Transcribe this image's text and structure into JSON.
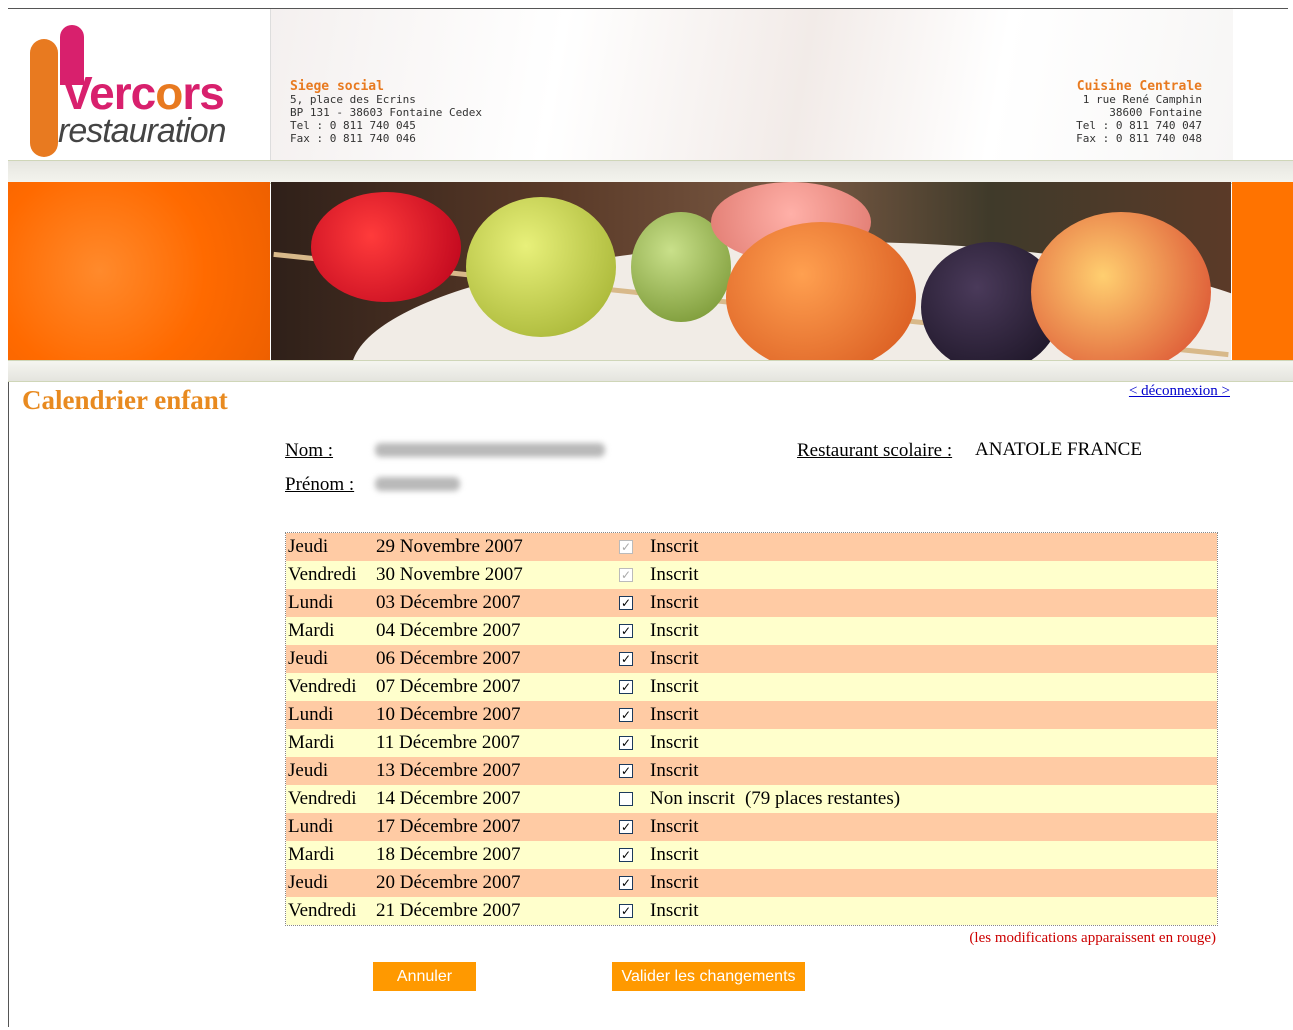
{
  "brand": {
    "logo_text_main": "Vercors",
    "logo_text_sub": "restauration"
  },
  "header": {
    "left_office": {
      "title": "Siege social",
      "lines": [
        "5, place des Ecrins",
        "BP 131 - 38603 Fontaine Cedex",
        "Tel :  0 811 740 045",
        "Fax : 0 811 740 046"
      ]
    },
    "right_office": {
      "title": "Cuisine Centrale",
      "lines": [
        "1 rue René Camphin",
        "38600 Fontaine",
        "Tel : 0 811 740 047",
        "Fax : 0 811 740 048"
      ]
    }
  },
  "page": {
    "title": "Calendrier enfant",
    "logout_link": "< déconnexion >"
  },
  "child": {
    "nom_label": "Nom :",
    "prenom_label": "Prénom :",
    "restaurant_label": "Restaurant scolaire :",
    "restaurant_value": "ANATOLE FRANCE"
  },
  "calendar": [
    {
      "day": "Jeudi",
      "date": "29 Novembre 2007",
      "checked": true,
      "disabled": true,
      "status": "Inscrit",
      "extra": ""
    },
    {
      "day": "Vendredi",
      "date": "30 Novembre 2007",
      "checked": true,
      "disabled": true,
      "status": "Inscrit",
      "extra": ""
    },
    {
      "day": "Lundi",
      "date": "03 Décembre 2007",
      "checked": true,
      "disabled": false,
      "status": "Inscrit",
      "extra": ""
    },
    {
      "day": "Mardi",
      "date": "04 Décembre 2007",
      "checked": true,
      "disabled": false,
      "status": "Inscrit",
      "extra": ""
    },
    {
      "day": "Jeudi",
      "date": "06 Décembre 2007",
      "checked": true,
      "disabled": false,
      "status": "Inscrit",
      "extra": ""
    },
    {
      "day": "Vendredi",
      "date": "07 Décembre 2007",
      "checked": true,
      "disabled": false,
      "status": "Inscrit",
      "extra": ""
    },
    {
      "day": "Lundi",
      "date": "10 Décembre 2007",
      "checked": true,
      "disabled": false,
      "status": "Inscrit",
      "extra": ""
    },
    {
      "day": "Mardi",
      "date": "11 Décembre 2007",
      "checked": true,
      "disabled": false,
      "status": "Inscrit",
      "extra": ""
    },
    {
      "day": "Jeudi",
      "date": "13 Décembre 2007",
      "checked": true,
      "disabled": false,
      "status": "Inscrit",
      "extra": ""
    },
    {
      "day": "Vendredi",
      "date": "14 Décembre 2007",
      "checked": false,
      "disabled": false,
      "status": "Non inscrit",
      "extra": "(79 places restantes)"
    },
    {
      "day": "Lundi",
      "date": "17 Décembre 2007",
      "checked": true,
      "disabled": false,
      "status": "Inscrit",
      "extra": ""
    },
    {
      "day": "Mardi",
      "date": "18 Décembre 2007",
      "checked": true,
      "disabled": false,
      "status": "Inscrit",
      "extra": ""
    },
    {
      "day": "Jeudi",
      "date": "20 Décembre 2007",
      "checked": true,
      "disabled": false,
      "status": "Inscrit",
      "extra": ""
    },
    {
      "day": "Vendredi",
      "date": "21 Décembre 2007",
      "checked": true,
      "disabled": false,
      "status": "Inscrit",
      "extra": ""
    }
  ],
  "note": "(les modifications apparaissent en rouge)",
  "buttons": {
    "cancel": "Annuler",
    "submit": "Valider les changements"
  },
  "colors": {
    "row_odd": "#ffcba4",
    "row_even": "#ffffcc",
    "accent": "#ff9900",
    "title": "#e88a20"
  }
}
